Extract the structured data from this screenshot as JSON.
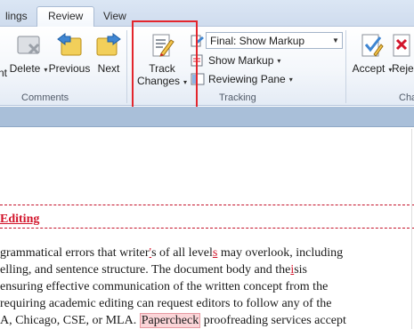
{
  "tabs": [
    {
      "label": "lings"
    },
    {
      "label": "Review"
    },
    {
      "label": "View"
    }
  ],
  "comments_group": {
    "label": "Comments",
    "partial_label": "nt",
    "delete_label": "Delete",
    "previous_label": "Previous",
    "next_label": "Next"
  },
  "tracking_group": {
    "label": "Tracking",
    "track_changes_line1": "Track",
    "track_changes_line2": "Changes",
    "display_for_review": "Final: Show Markup",
    "show_markup": "Show Markup",
    "reviewing_pane": "Reviewing Pane"
  },
  "changes_group": {
    "accept_label": "Accept",
    "reject_label": "Rejec",
    "group_label_partial": "Cha"
  },
  "document": {
    "heading": "Editing",
    "lines": [
      {
        "pre": "grammatical errors that writer",
        "ins1": "'",
        "mid": "s of all level",
        "ins2": "s",
        "post": " may overlook, including"
      },
      {
        "pre": "elling, and sentence structure. The document body and the",
        "ins1": "i",
        "mid": "",
        "ins2": "",
        "post": "sis"
      },
      {
        "pre": "ensuring effective communication of the written concept from the",
        "ins1": "",
        "mid": "",
        "ins2": "",
        "post": ""
      },
      {
        "pre": " requiring academic editing can request editors to follow any of the",
        "ins1": "",
        "mid": "",
        "ins2": "",
        "post": ""
      },
      {
        "pre": "A, Chicago, CSE, or MLA. ",
        "box": "Papercheck",
        "post": " proofreading services accept"
      }
    ]
  },
  "colors": {
    "ribbon_bg": "#f4f7fb",
    "tab_strip": "#dbe6f4",
    "highlight_box": "#e3262d",
    "tracked_insert": "#d2152b"
  },
  "icons": [
    "delete-comment-icon",
    "previous-comment-icon",
    "next-comment-icon",
    "track-changes-icon",
    "display-for-review-icon",
    "show-markup-icon",
    "reviewing-pane-icon",
    "accept-icon",
    "reject-icon"
  ]
}
